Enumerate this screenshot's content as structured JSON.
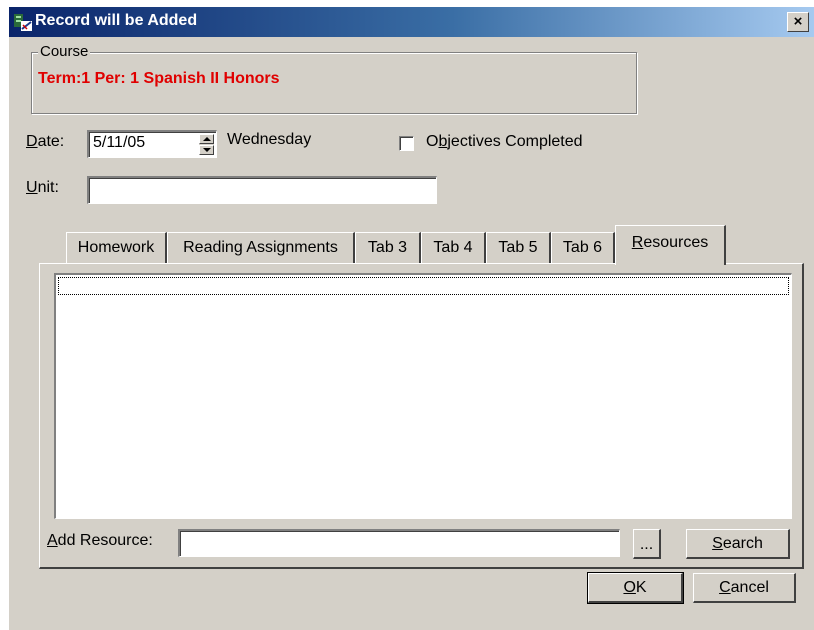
{
  "window": {
    "title": "Record will be Added",
    "close_label": "×"
  },
  "course": {
    "legend": "Course",
    "value": "Term:1 Per: 1 Spanish II Honors"
  },
  "date": {
    "label_underlined": "D",
    "label_rest": "ate:",
    "value": "5/11/05",
    "weekday": "Wednesday"
  },
  "objectives": {
    "label_pre": "O",
    "label_underlined": "b",
    "label_rest": "jectives Completed",
    "checked": false
  },
  "unit": {
    "label_underlined": "U",
    "label_rest": "nit:",
    "value": ""
  },
  "tabs": [
    {
      "label": "Homework"
    },
    {
      "label": "Reading Assignments"
    },
    {
      "label": "Tab 3"
    },
    {
      "label": "Tab 4"
    },
    {
      "label": "Tab 5"
    },
    {
      "label": "Tab 6"
    },
    {
      "label_underlined": "R",
      "label_rest": "esources",
      "active": true
    }
  ],
  "resources": {
    "list_items": [],
    "add_label_pre": "A",
    "add_label_rest": "dd Resource:",
    "add_value": "",
    "browse_label": "...",
    "search_underlined": "S",
    "search_rest": "earch"
  },
  "buttons": {
    "ok_underlined": "O",
    "ok_rest": "K",
    "cancel_underlined": "C",
    "cancel_rest": "ancel"
  }
}
